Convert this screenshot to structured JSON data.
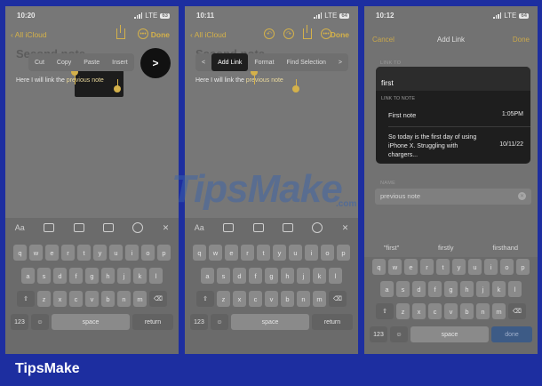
{
  "panel1": {
    "time": "10:20",
    "network": "LTE",
    "battery": "63",
    "back": "All iCloud",
    "done": "Done",
    "title": "Second note",
    "body_prefix": "Here I will link the ",
    "body_selected": "previous note",
    "menu": [
      "Cut",
      "Copy",
      "Paste",
      "Insert"
    ],
    "more_arrow": ">"
  },
  "panel2": {
    "time": "10:11",
    "network": "LTE",
    "battery": "64",
    "back": "All iCloud",
    "done": "Done",
    "title": "Second note",
    "body_prefix": "Here I will link the ",
    "body_selected": "previous note",
    "menu": [
      "<",
      "Add Link",
      "Format",
      "Find Selection",
      ">"
    ]
  },
  "panel3": {
    "time": "10:12",
    "network": "LTE",
    "battery": "64",
    "cancel": "Cancel",
    "header": "Add Link",
    "done": "Done",
    "link_to_label": "LINK TO",
    "link_to_value": "first",
    "link_to_note_label": "LINK TO NOTE",
    "notes": [
      {
        "title": "First note",
        "date": "1:05PM"
      },
      {
        "title": "So today is the first day of using iPhone X. Struggling with chargers...",
        "date": "10/11/22"
      }
    ],
    "name_label": "NAME",
    "name_value": "previous note",
    "suggestions": [
      "\"first\"",
      "firstly",
      "firsthand"
    ]
  },
  "keyboard": {
    "row1": [
      "q",
      "w",
      "e",
      "r",
      "t",
      "y",
      "u",
      "i",
      "o",
      "p"
    ],
    "row2": [
      "a",
      "s",
      "d",
      "f",
      "g",
      "h",
      "j",
      "k",
      "l"
    ],
    "row3": [
      "z",
      "x",
      "c",
      "v",
      "b",
      "n",
      "m"
    ],
    "numbers": "123",
    "space": "space",
    "return": "return",
    "done": "done"
  },
  "toolbar": [
    "Aa"
  ],
  "watermark": {
    "brand": "TipsMake",
    "suffix": ".com"
  },
  "footer": "TipsMake",
  "colors": {
    "accent": "#d4b14a",
    "background": "#1d2ea0"
  }
}
